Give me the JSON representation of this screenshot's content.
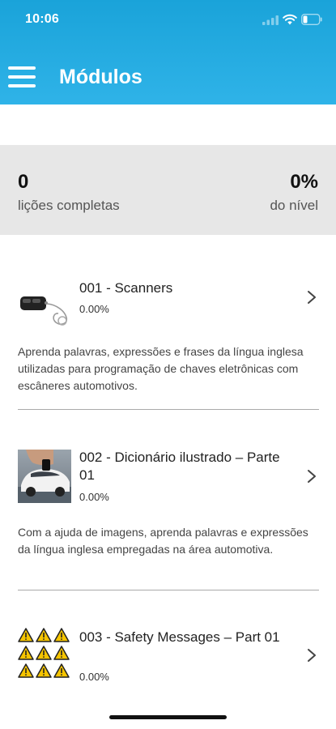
{
  "status_bar": {
    "time": "10:06"
  },
  "header": {
    "title": "Módulos"
  },
  "stats": {
    "lessons_value": "0",
    "lessons_label": "lições completas",
    "level_value": "0%",
    "level_label": "do nível"
  },
  "modules": [
    {
      "title": "001 - Scanners",
      "progress": "0.00%",
      "description": "Aprenda palavras, expressões e frases da língua inglesa utilizadas para programação de chaves eletrônicas com escâneres automotivos.",
      "thumbnail": "car-key-icon"
    },
    {
      "title": "002 - Dicionário ilustrado – Parte 01",
      "progress": "0.00%",
      "description": "Com a ajuda de imagens, aprenda palavras e expressões da língua inglesa empregadas na área automotiva.",
      "thumbnail": "car-photo"
    },
    {
      "title": "003 - Safety Messages – Part 01",
      "progress": "0.00%",
      "description": "",
      "thumbnail": "warning-signs-icon"
    }
  ],
  "colors": {
    "header": "#1aa3d9",
    "stats_bg": "#e7e7e7",
    "warning": "#f5c400"
  }
}
